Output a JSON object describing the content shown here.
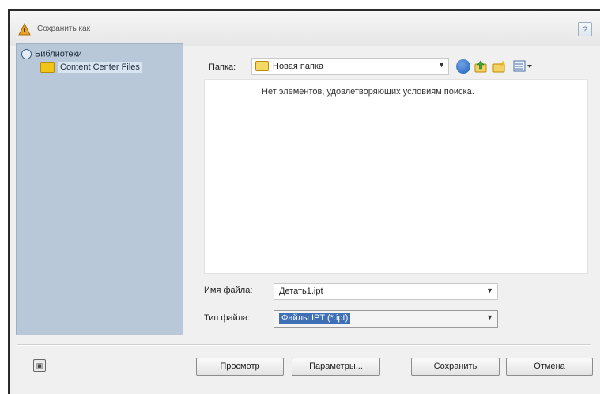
{
  "window": {
    "title": "Сохранить как"
  },
  "tree": {
    "root_label": "Библиотеки",
    "child_label": "Content Center Files"
  },
  "location": {
    "label": "Папка:",
    "value": "Новая папка"
  },
  "file_list": {
    "empty_message": "Нет элементов, удовлетворяющих условиям поиска."
  },
  "file_name": {
    "label": "Имя файла:",
    "value": "Детать1.ipt"
  },
  "file_type": {
    "label": "Тип файла:",
    "value": "Файлы IPT (*.ipt)"
  },
  "buttons": {
    "preview": "Просмотр",
    "options": "Параметры...",
    "save": "Сохранить",
    "cancel": "Отмена"
  },
  "icons": {
    "app": "inventor-logo-icon",
    "help": "help-icon",
    "back": "back-icon",
    "up": "up-folder-icon",
    "new_folder": "new-folder-icon",
    "view": "view-menu-icon",
    "corner": "preview-toggle-icon"
  },
  "colors": {
    "tree_panel": "#b9c8d8",
    "selection": "#3f6fb5",
    "folder": "#f0c419"
  }
}
